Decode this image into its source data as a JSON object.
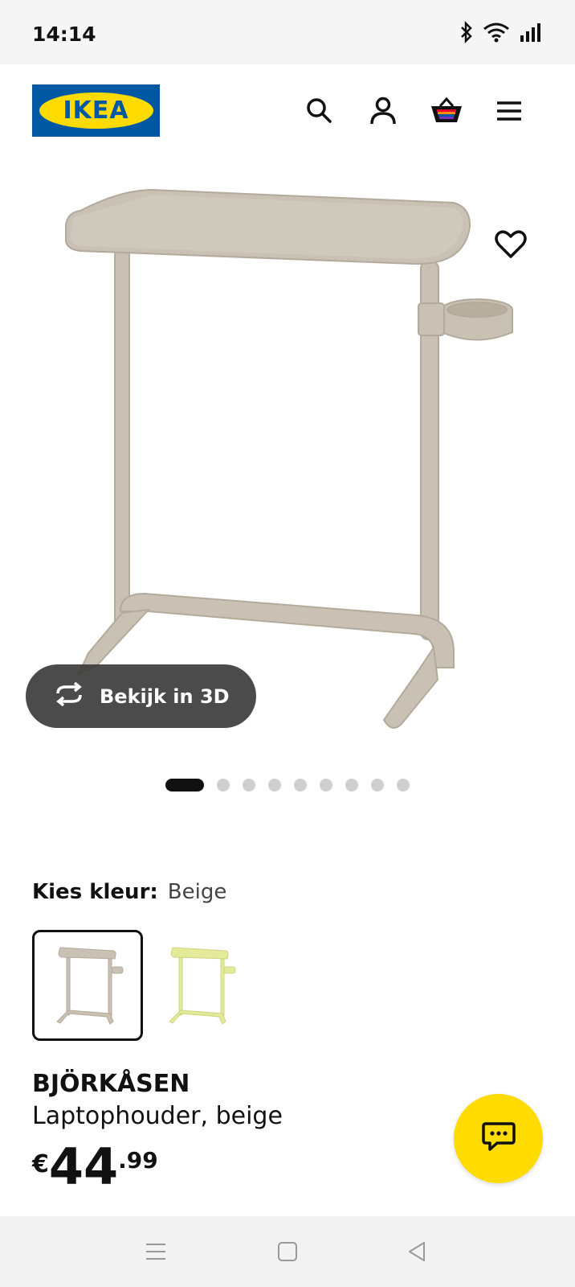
{
  "status_bar": {
    "time": "14:14",
    "icons": [
      "bluetooth-icon",
      "wifi-icon",
      "signal-icon"
    ]
  },
  "header": {
    "logo_text": "IKEA",
    "icons": [
      "search-icon",
      "account-icon",
      "cart-icon",
      "menu-icon"
    ]
  },
  "gallery": {
    "view_3d_label": "Bekijk in 3D",
    "image_count": 9,
    "active_index": 0
  },
  "color_picker": {
    "label": "Kies kleur:",
    "selected_value": "Beige",
    "options": [
      {
        "color": "#c9c1b4",
        "selected": true
      },
      {
        "color": "#e3ea9a",
        "selected": false
      }
    ]
  },
  "product": {
    "name": "BJÖRKÅSEN",
    "description": "Laptophouder, beige",
    "price_currency": "€",
    "price_integer": "44",
    "price_decimal": ".99"
  },
  "colors": {
    "ikea_blue": "#0058a3",
    "ikea_yellow": "#ffdb00",
    "product_beige": "#c9c1b4"
  }
}
